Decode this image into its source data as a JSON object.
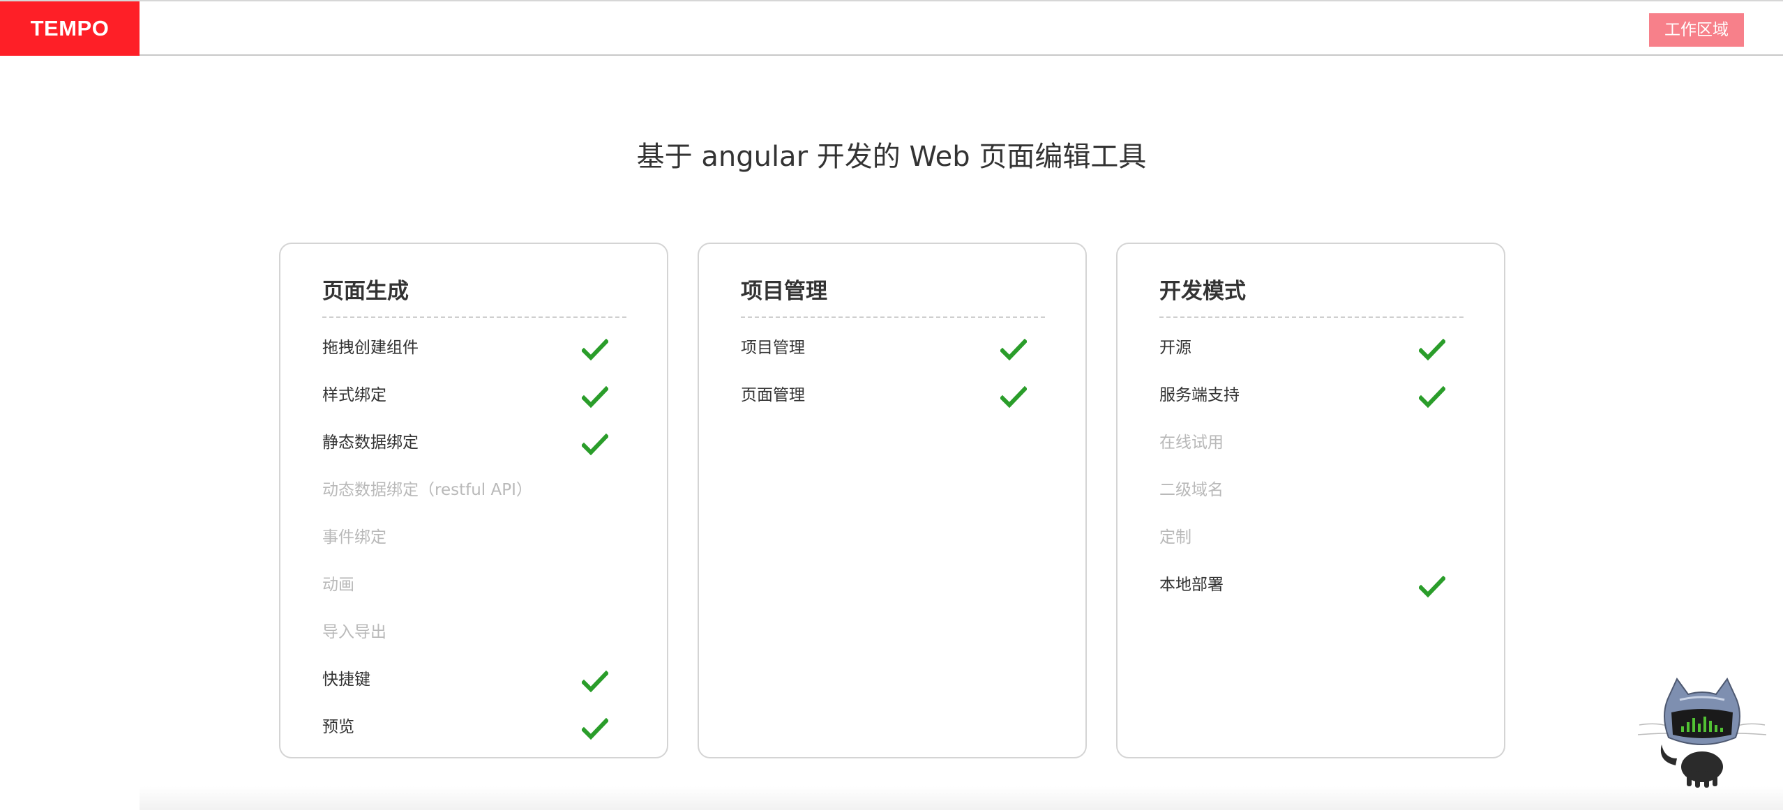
{
  "header": {
    "logo_text": "TEMPO",
    "workspace_button": "工作区域",
    "logo_color": "#fe1f27",
    "workspace_button_color": "#f7808a"
  },
  "main": {
    "headline": "基于 angular 开发的 Web 页面编辑工具"
  },
  "cards": [
    {
      "title": "页面生成",
      "features": [
        {
          "label": "拖拽创建组件",
          "supported": true
        },
        {
          "label": "样式绑定",
          "supported": true
        },
        {
          "label": "静态数据绑定",
          "supported": true
        },
        {
          "label": "动态数据绑定（restful API）",
          "supported": false
        },
        {
          "label": "事件绑定",
          "supported": false
        },
        {
          "label": "动画",
          "supported": false
        },
        {
          "label": "导入导出",
          "supported": false
        },
        {
          "label": "快捷键",
          "supported": true
        },
        {
          "label": "预览",
          "supported": true
        }
      ]
    },
    {
      "title": "项目管理",
      "features": [
        {
          "label": "项目管理",
          "supported": true
        },
        {
          "label": "页面管理",
          "supported": true
        }
      ]
    },
    {
      "title": "开发模式",
      "features": [
        {
          "label": "开源",
          "supported": true
        },
        {
          "label": "服务端支持",
          "supported": true
        },
        {
          "label": "在线试用",
          "supported": false
        },
        {
          "label": "二级域名",
          "supported": false
        },
        {
          "label": "定制",
          "supported": false
        },
        {
          "label": "本地部署",
          "supported": true
        }
      ]
    }
  ],
  "icons": {
    "check": "check-icon",
    "check_color": "#2a9d2a",
    "mascot": "octocat-icon"
  }
}
